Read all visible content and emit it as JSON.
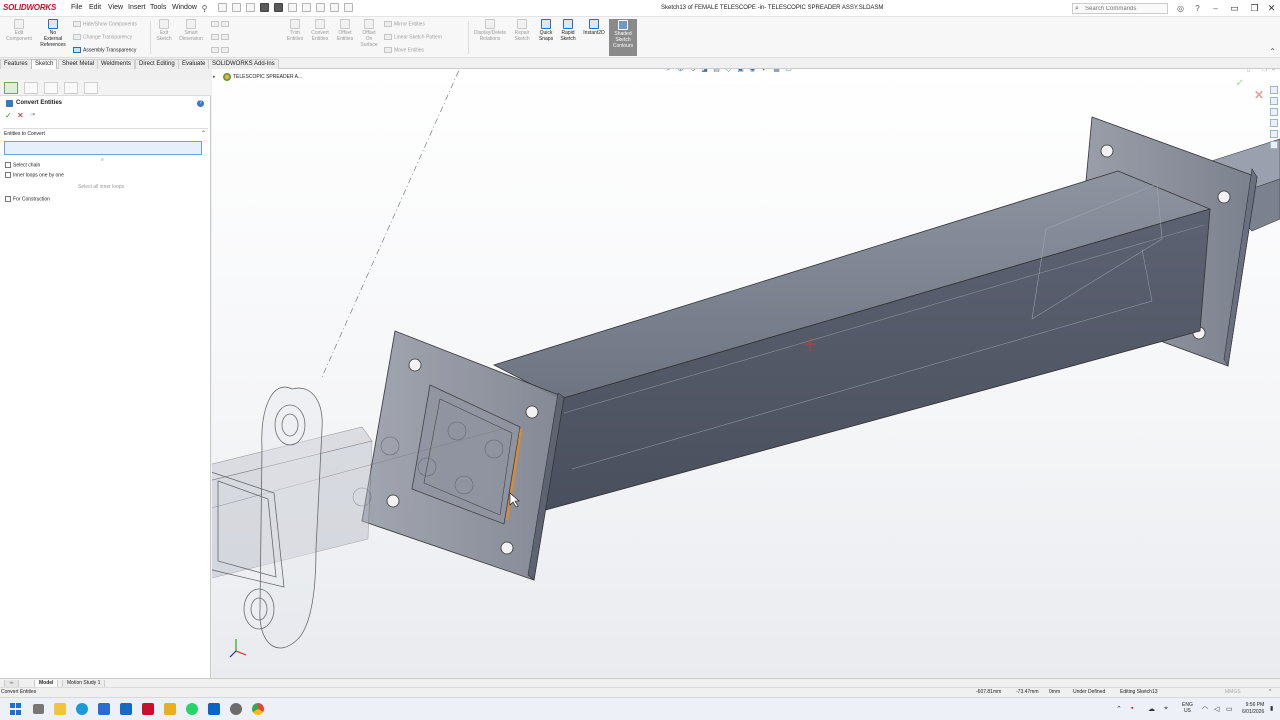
{
  "app": {
    "logo_text": "SOLIDWORKS",
    "document_title": "Sketch13 of FEMALE TELESCOPE -in- TELESCOPIC SPREADER ASSY.SLDASM"
  },
  "menu": [
    "File",
    "Edit",
    "View",
    "Insert",
    "Tools",
    "Window"
  ],
  "search": {
    "placeholder": "Search Commands"
  },
  "ribbon": {
    "edit_component": "Edit\nComponent",
    "no_external_references": "No\nExternal\nReferences",
    "hide_show_components": "Hide/Show Components",
    "change_transparency": "Change Transparency",
    "assembly_transparency": "Assembly Transparency",
    "exit_sketch": "Exit\nSketch",
    "smart_dimension": "Smart\nDimension",
    "trim_entities": "Trim\nEntities",
    "convert_entities": "Convert\nEntities",
    "offset_entities": "Offset\nEntities",
    "offset_on_surface": "Offset\nOn\nSurface",
    "mirror_entities": "Mirror Entities",
    "linear_sketch_pattern": "Linear Sketch Pattern",
    "move_entities": "Move Entities",
    "display_delete_relations": "Display/Delete\nRelations",
    "repair_sketch": "Repair\nSketch",
    "quick_snaps": "Quick\nSnaps",
    "rapid_sketch": "Rapid\nSketch",
    "instant2d": "Instant2D",
    "shaded_sketch_contours": "Shaded\nSketch\nContours"
  },
  "command_tabs": [
    "Features",
    "Sketch",
    "Sheet Metal",
    "Weldments",
    "Direct Editing",
    "Evaluate",
    "SOLIDWORKS Add-Ins"
  ],
  "active_command_tab": "Sketch",
  "property_manager": {
    "title": "Convert Entities",
    "group_title": "Entities to Convert",
    "selection_value": "",
    "select_chain": "Select chain",
    "inner_loops": "Inner loops one by one",
    "select_all_inner_loops": "Select all inner loops",
    "for_construction": "For Construction"
  },
  "feature_tree": {
    "top_item": "TELESCOPIC SPREADER A..."
  },
  "bottom_tabs": [
    "Model",
    "Motion Study 1"
  ],
  "statusbar": {
    "left": "Convert Entities",
    "x": "-607.81mm",
    "y": "-73.47mm",
    "z": "0mm",
    "state": "Under Defined",
    "editing": "Editing Sketch13",
    "units": "MMGS"
  },
  "taskbar": {
    "lang_1": "ENG",
    "lang_2": "US",
    "time": "9:56 PM",
    "date": "6/01/2026"
  },
  "colors": {
    "accent": "#c8102e",
    "selection": "#6fa0d8",
    "ok": "#2e9a2e",
    "cancel": "#c8201e",
    "model_top": "#7a7f8c",
    "model_side": "#5b6070",
    "edge_highlight": "#e08a2a"
  }
}
